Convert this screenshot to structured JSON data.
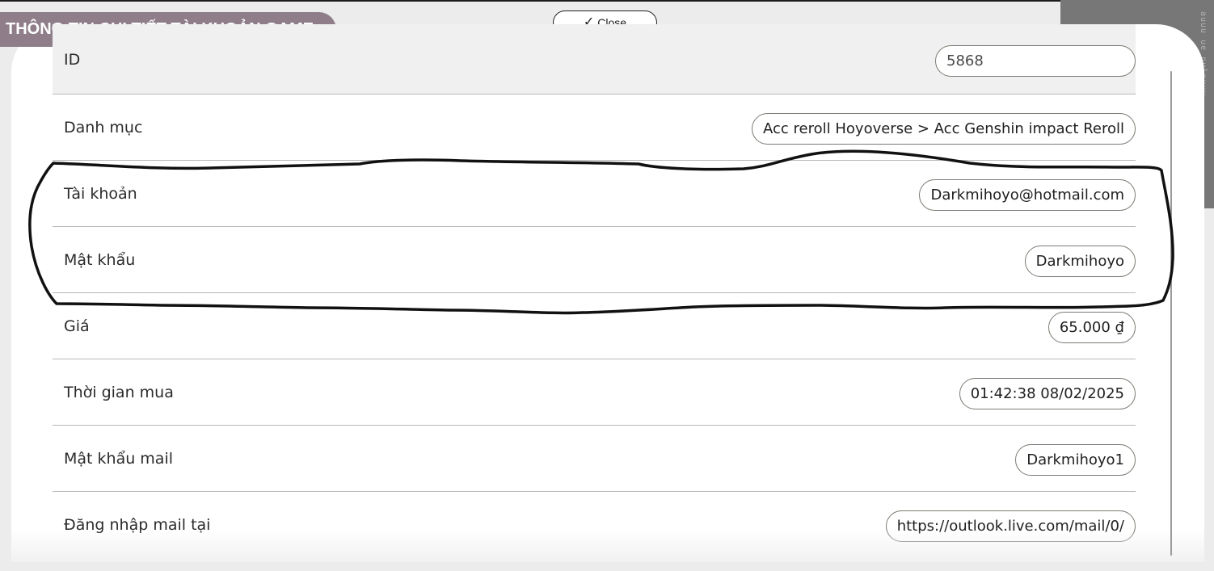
{
  "dialog": {
    "title": "THÔNG TIN CHI TIẾT TÀI KHOẢN GAME",
    "close_label": "Close",
    "side_tab_text": "auuu ue nulnuuu"
  },
  "details": [
    {
      "label": "ID",
      "value": "5868"
    },
    {
      "label": "Danh mục",
      "value": "Acc reroll Hoyoverse > Acc Genshin impact Reroll"
    },
    {
      "label": "Tài khoản",
      "value": "Darkmihoyo@hotmail.com"
    },
    {
      "label": "Mật khẩu",
      "value": "Darkmihoyo"
    },
    {
      "label": "Giá",
      "value": "65.000 ₫"
    },
    {
      "label": "Thời gian mua",
      "value": "01:42:38 08/02/2025"
    },
    {
      "label": "Mật khẩu mail",
      "value": "Darkmihoyo1"
    },
    {
      "label": "Đăng nhập mail tại",
      "value": "https://outlook.live.com/mail/0/"
    }
  ],
  "icons": {
    "close": "check-icon"
  },
  "colors": {
    "title_background": "#8f7e8a",
    "side_tab": "#777777",
    "highlight_stroke": "#111111",
    "first_row_background": "#f0f0f0"
  }
}
